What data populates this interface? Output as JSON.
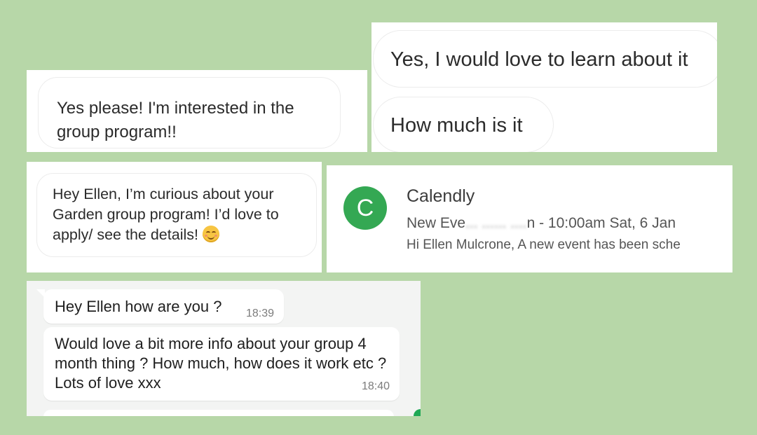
{
  "card1": {
    "message": "Yes please! I'm interested in the group program!!"
  },
  "card2": {
    "message1": "Yes, I would love to learn about it",
    "message2": "How much is it"
  },
  "card3": {
    "message": "Hey Ellen, I’m curious about your Garden group program! I’d love to apply/ see the details!",
    "emoji_icon": "smiling-face-icon"
  },
  "card4": {
    "avatar_letter": "C",
    "avatar_color": "#34a853",
    "sender": "Calendly",
    "subject_start": "New Eve",
    "subject_blurred": "... ...... ....",
    "subject_end": "n - 10:00am Sat, 6 Jan",
    "preview": "Hi Ellen Mulcrone, A new event has been sche"
  },
  "card5": {
    "message1": "Hey Ellen how are you ?",
    "time1": "18:39",
    "message2": "Would love a bit more info about your group 4 month thing ? How much, how does it work etc ? Lots of love xxx",
    "time2": "18:40"
  }
}
